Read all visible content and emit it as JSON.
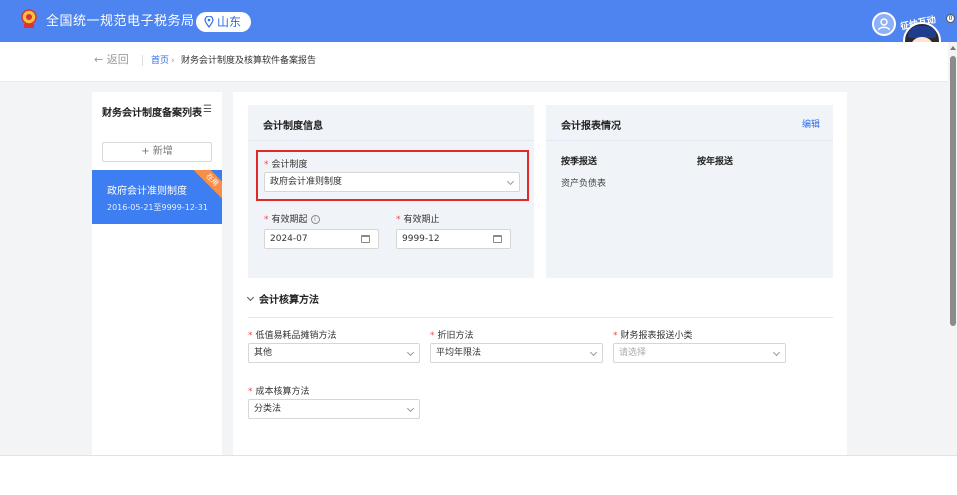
{
  "header": {
    "title": "全国统一规范电子税务局",
    "region": "山东",
    "mascot_label": "征纳互动",
    "notification_count": "0"
  },
  "breadcrumb": {
    "back": "← 返回",
    "home": "首页",
    "separator": "›",
    "current": "财务会计制度及核算软件备案报告"
  },
  "sidebar": {
    "title": "财务会计制度备案列表",
    "add_button": "+ 新增",
    "items": [
      {
        "name": "政府会计准则制度",
        "date_range": "2016-05-21至9999-12-31",
        "tag": "在用"
      }
    ]
  },
  "accounting_info": {
    "title": "会计制度信息",
    "system_label": "会计制度",
    "system_value": "政府会计准则制度",
    "start_label": "有效期起",
    "start_value": "2024-07",
    "end_label": "有效期止",
    "end_value": "9999-12"
  },
  "report_info": {
    "title": "会计报表情况",
    "edit": "编辑",
    "quarterly_header": "按季报送",
    "annual_header": "按年报送",
    "quarterly_items": [
      "资产负债表"
    ]
  },
  "accounting_method": {
    "title": "会计核算方法",
    "low_value_label": "低值易耗品摊销方法",
    "low_value_value": "其他",
    "depreciation_label": "折旧方法",
    "depreciation_value": "平均年限法",
    "report_category_label": "财务报表报送小类",
    "report_category_placeholder": "请选择",
    "cost_label": "成本核算方法",
    "cost_value": "分类法"
  },
  "colors": {
    "primary": "#4e84ef",
    "accent_blue": "#2f6ee7",
    "active_item": "#3d7ef3",
    "tag_orange": "#f78f4b",
    "required_red": "#f04848",
    "highlight_red": "#e02a2a"
  }
}
